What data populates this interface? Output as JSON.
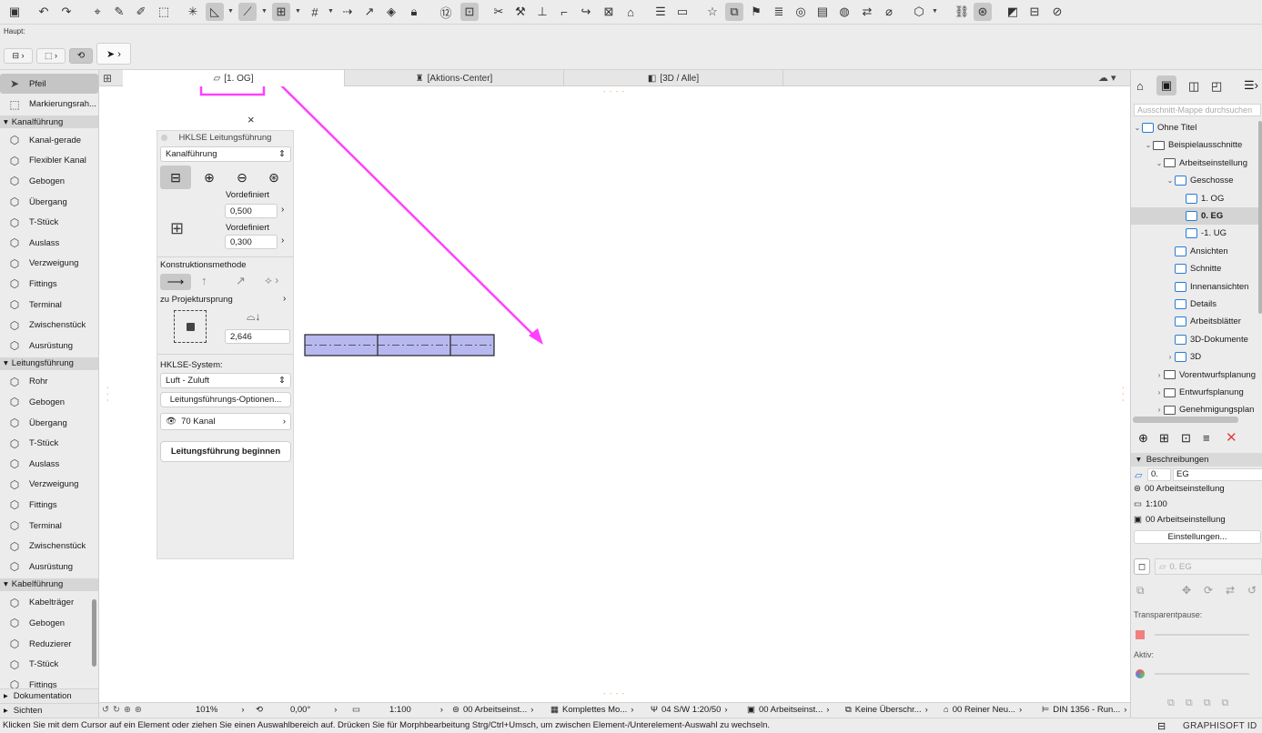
{
  "toolbar": {
    "subbar_label": "Haupt:",
    "icons": [
      "save-icon",
      "undo-icon",
      "redo-icon",
      "pick-icon",
      "eyedropper-icon",
      "inject-icon",
      "transform-icon",
      "snap-icon",
      "angle-icon",
      "guide-icon",
      "snap-point-icon",
      "grid-icon",
      "arrow-icon",
      "lock-icon",
      "number-icon",
      "group-icon",
      "trim-icon",
      "split-icon",
      "align-icon",
      "offset-icon",
      "fillet-icon",
      "resize-icon",
      "roof-icon",
      "ruler-icon",
      "window-icon",
      "favorites-icon",
      "view-select-icon",
      "flag-icon",
      "layers-icon",
      "teamwork-icon",
      "publish-icon",
      "3d-icon",
      "transfer-icon",
      "measure-icon",
      "model-icon",
      "link-icon",
      "mep-icon",
      "render-icon",
      "compare-icon",
      "issue-icon"
    ]
  },
  "view_tabs": [
    {
      "label": "[1. OG]"
    },
    {
      "label": "[Aktions-Center]"
    },
    {
      "label": "[3D / Alle]"
    }
  ],
  "left_panel": {
    "tools_top": [
      {
        "label": "Pfeil",
        "selected": true
      },
      {
        "label": "Markierungsrah..."
      }
    ],
    "groups": [
      {
        "title": "Kanalführung",
        "items": [
          "Kanal-gerade",
          "Flexibler Kanal",
          "Gebogen",
          "Übergang",
          "T-Stück",
          "Auslass",
          "Verzweigung",
          "Fittings",
          "Terminal",
          "Zwischenstück",
          "Ausrüstung"
        ]
      },
      {
        "title": "Leitungsführung",
        "items": [
          "Rohr",
          "Gebogen",
          "Übergang",
          "T-Stück",
          "Auslass",
          "Verzweigung",
          "Fittings",
          "Terminal",
          "Zwischenstück",
          "Ausrüstung"
        ]
      },
      {
        "title": "Kabelführung",
        "items": [
          "Kabelträger",
          "Gebogen",
          "Reduzierer",
          "T-Stück",
          "Fittings"
        ]
      }
    ],
    "footer": [
      "Dokumentation",
      "Sichten"
    ]
  },
  "infobox": {
    "title": "HKLSE Leitungsführung",
    "close": "×",
    "type_select": "Kanalführung",
    "vordefiniert_1": "Vordefiniert",
    "value_1": "0,500",
    "vordefiniert_2": "Vordefiniert",
    "value_2": "0,300",
    "construction_label": "Konstruktionsmethode",
    "projection_label": "zu Projektursprung",
    "offset_value": "2,646",
    "system_label": "HKLSE-System:",
    "system_select": "Luft - Zuluft",
    "options_button": "Leitungsführungs-Optionen...",
    "layer_label": "70 Kanal",
    "begin_button": "Leitungsführung beginnen"
  },
  "right_panel": {
    "search_placeholder": "Ausschnitt-Mappe durchsuchen",
    "tree": [
      {
        "label": "Ohne Titel",
        "level": 0,
        "arrow": "v",
        "kind": "view"
      },
      {
        "label": "Beispielausschnitte",
        "level": 1,
        "arrow": "v",
        "kind": "folder"
      },
      {
        "label": "Arbeitseinstellung",
        "level": 2,
        "arrow": "v",
        "kind": "folder"
      },
      {
        "label": "Geschosse",
        "level": 3,
        "arrow": "v",
        "kind": "view"
      },
      {
        "label": "1. OG",
        "level": 4,
        "arrow": "",
        "kind": "view"
      },
      {
        "label": "0. EG",
        "level": 4,
        "arrow": "",
        "kind": "view",
        "selected": true
      },
      {
        "label": "-1. UG",
        "level": 4,
        "arrow": "",
        "kind": "view"
      },
      {
        "label": "Ansichten",
        "level": 3,
        "arrow": "",
        "kind": "view"
      },
      {
        "label": "Schnitte",
        "level": 3,
        "arrow": "",
        "kind": "view"
      },
      {
        "label": "Innenansichten",
        "level": 3,
        "arrow": "",
        "kind": "view"
      },
      {
        "label": "Details",
        "level": 3,
        "arrow": "",
        "kind": "view"
      },
      {
        "label": "Arbeitsblätter",
        "level": 3,
        "arrow": "",
        "kind": "view"
      },
      {
        "label": "3D-Dokumente",
        "level": 3,
        "arrow": "",
        "kind": "view"
      },
      {
        "label": "3D",
        "level": 3,
        "arrow": ">",
        "kind": "view"
      },
      {
        "label": "Vorentwurfsplanung",
        "level": 2,
        "arrow": ">",
        "kind": "folder"
      },
      {
        "label": "Entwurfsplanung",
        "level": 2,
        "arrow": ">",
        "kind": "folder"
      },
      {
        "label": "Genehmigungsplan",
        "level": 2,
        "arrow": ">",
        "kind": "folder"
      }
    ],
    "props_header": "Beschreibungen",
    "props_id": "0.",
    "props_name": "EG",
    "props_rows": [
      "00 Arbeitseinstellung",
      "1:100",
      "00 Arbeitseinstellung"
    ],
    "settings_button": "Einstellungen...",
    "view_field": "0. EG",
    "transparency_label": "Transparentpause:",
    "active_label": "Aktiv:"
  },
  "status_row": {
    "zoom": "101%",
    "angle": "0,00°",
    "scale": "1:100",
    "layer_combo": "00 Arbeitseinst...",
    "model": "Komplettes Mo...",
    "pen_set": "04 S/W 1:20/50",
    "view_combo": "00 Arbeitseinst...",
    "override": "Keine Überschr...",
    "renovation": "00 Reiner Neu...",
    "dimension": "DIN 1356 - Run..."
  },
  "message": "Klicken Sie mit dem Cursor auf ein Element oder ziehen Sie einen Auswahlbereich auf. Drücken Sie für Morphbearbeitung Strg/Ctrl+Umsch, um zwischen Element-/Unterelement-Auswahl zu wechseln.",
  "brand": "GRAPHISOFT ID",
  "colors": {
    "annotation": "#ff40ff",
    "duct_fill": "#b8b8f0",
    "selection": "#c5c5c5"
  }
}
